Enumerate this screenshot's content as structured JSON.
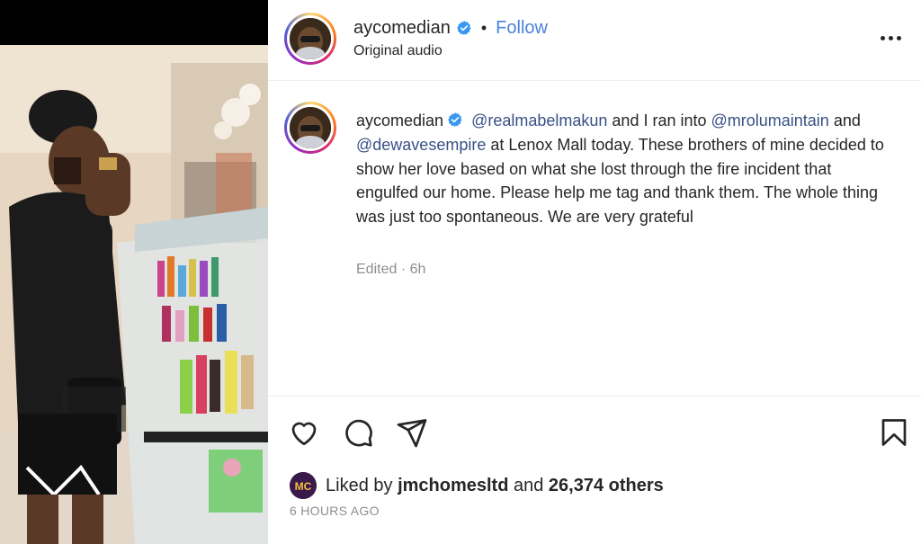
{
  "post": {
    "username": "aycomedian",
    "follow_label": "Follow",
    "audio_label": "Original audio",
    "dot": "•"
  },
  "caption": {
    "username": "aycomedian",
    "mention_1": "@realmabelmakun",
    "text_1": " and I ran into ",
    "mention_2": "@mrolumaintain",
    "text_2": " and ",
    "mention_3": "@dewavesempire",
    "text_3": " at Lenox Mall today. These brothers of mine decided to show her love based on what she lost through the fire incident that engulfed our home. Please help me tag and thank them. The whole thing was just too spontaneous. We are very grateful",
    "edited": "Edited · 6h"
  },
  "likes": {
    "prefix": "Liked by ",
    "user": "jmchomesltd",
    "middle": " and ",
    "others": "26,374 others",
    "avatar_text": "MC"
  },
  "time_ago": "6 HOURS AGO",
  "icons": {
    "like": "heart-icon",
    "comment": "comment-icon",
    "share": "share-icon",
    "save": "bookmark-icon",
    "more": "more-icon",
    "verified": "verified-icon"
  },
  "colors": {
    "link": "#385185",
    "follow": "#4a83d9",
    "muted": "#8e8e8e",
    "verified": "#3897f0"
  }
}
